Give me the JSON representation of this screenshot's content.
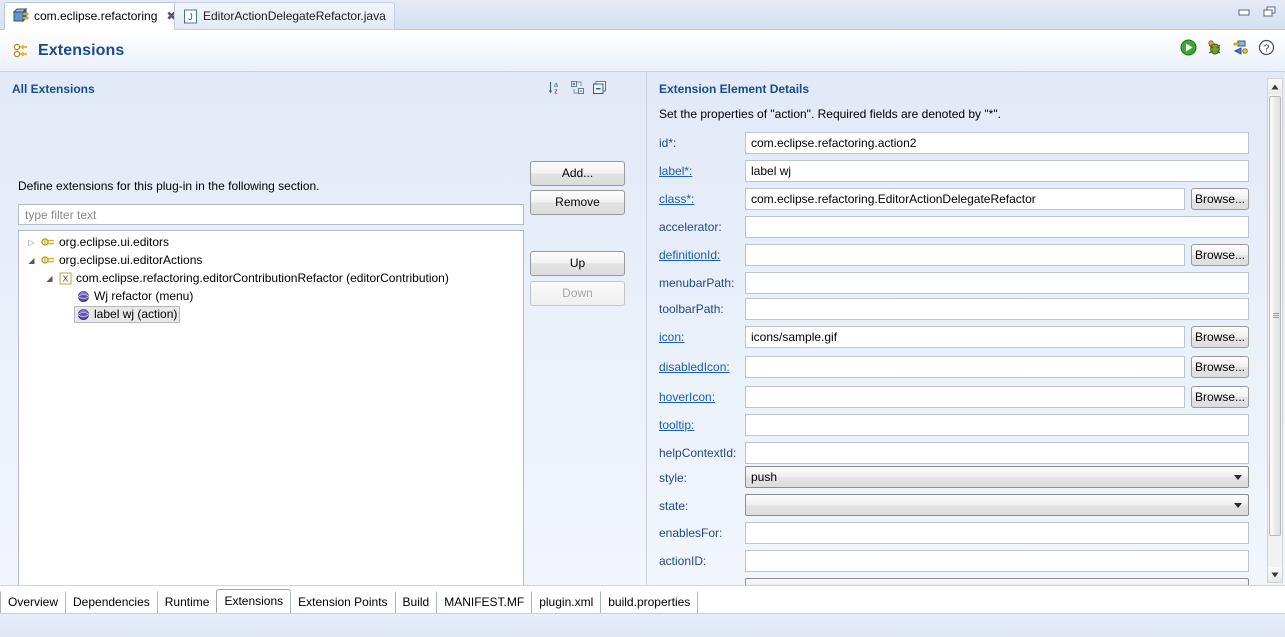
{
  "window": {
    "minimize_label": "minimize",
    "maximize_label": "maximize"
  },
  "editor_tabs": [
    {
      "label": "com.eclipse.refactoring",
      "icon": "plugin-icon",
      "active": true,
      "close": "✖"
    },
    {
      "label": "EditorActionDelegateRefactor.java",
      "icon": "java-file-icon",
      "active": false
    }
  ],
  "form_header": {
    "title": "Extensions",
    "icon": "extensions-icon",
    "tools": [
      {
        "name": "run-icon",
        "title": "Launch an Eclipse application"
      },
      {
        "name": "debug-icon",
        "title": "Launch an Eclipse application in Debug mode"
      },
      {
        "name": "export-plugin-icon",
        "title": "Export Wizard"
      },
      {
        "name": "help-icon",
        "title": "Help"
      }
    ]
  },
  "left_section": {
    "title": "All Extensions",
    "description": "Define extensions for this plug-in in the following section.",
    "tools": [
      {
        "name": "sort-az-icon",
        "title": "Sort alphabetically"
      },
      {
        "name": "expand-collapse-icon",
        "title": "Expand/Collapse"
      },
      {
        "name": "collapse-all-icon",
        "title": "Collapse All"
      }
    ],
    "filter": {
      "placeholder": "type filter text",
      "value": ""
    },
    "tree": [
      {
        "depth": 0,
        "twisty": "collapsed",
        "icon": "extension-point-icon",
        "label": "org.eclipse.ui.editors",
        "selected": false
      },
      {
        "depth": 0,
        "twisty": "expanded",
        "icon": "extension-point-icon",
        "label": "org.eclipse.ui.editorActions",
        "selected": false
      },
      {
        "depth": 1,
        "twisty": "expanded",
        "icon": "xml-element-icon",
        "label": "com.eclipse.refactoring.editorContributionRefactor (editorContribution)",
        "selected": false
      },
      {
        "depth": 2,
        "twisty": "none",
        "icon": "element-sphere-icon",
        "label": "Wj refactor (menu)",
        "selected": false
      },
      {
        "depth": 2,
        "twisty": "none",
        "icon": "element-sphere-icon",
        "label": "label wj (action)",
        "selected": true
      }
    ],
    "buttons": [
      {
        "label": "Add...",
        "enabled": true
      },
      {
        "label": "Remove",
        "enabled": true
      },
      {
        "label": "Up",
        "enabled": true
      },
      {
        "label": "Down",
        "enabled": false
      }
    ]
  },
  "right_section": {
    "title": "Extension Element Details",
    "description": "Set the properties of \"action\". Required fields are denoted by \"*\".",
    "fields": [
      {
        "label": "id*:",
        "link": false,
        "type": "text",
        "value": "com.eclipse.refactoring.action2",
        "browse": false
      },
      {
        "label": "label*:",
        "link": true,
        "type": "text",
        "value": "label wj",
        "browse": false
      },
      {
        "label": "class*:",
        "link": true,
        "type": "text",
        "value": "com.eclipse.refactoring.EditorActionDelegateRefactor",
        "browse": true,
        "browse_label": "Browse..."
      },
      {
        "label": "accelerator:",
        "link": false,
        "type": "text",
        "value": "",
        "browse": false
      },
      {
        "label": "definitionId:",
        "link": true,
        "type": "text",
        "value": "",
        "browse": true,
        "browse_label": "Browse..."
      },
      {
        "label": "menubarPath:",
        "link": false,
        "type": "text",
        "value": "",
        "browse": false
      },
      {
        "label": "toolbarPath:",
        "link": false,
        "type": "text",
        "value": "",
        "browse": false
      },
      {
        "label": "icon:",
        "link": true,
        "type": "text",
        "value": "icons/sample.gif",
        "browse": true,
        "browse_label": "Browse..."
      },
      {
        "label": "disabledIcon:",
        "link": true,
        "type": "text",
        "value": "",
        "browse": true,
        "browse_label": "Browse..."
      },
      {
        "label": "hoverIcon:",
        "link": true,
        "type": "text",
        "value": "",
        "browse": true,
        "browse_label": "Browse..."
      },
      {
        "label": "tooltip:",
        "link": true,
        "type": "text",
        "value": "",
        "browse": false
      },
      {
        "label": "helpContextId:",
        "link": false,
        "type": "text",
        "value": "",
        "browse": false
      },
      {
        "label": "style:",
        "link": false,
        "type": "combo",
        "value": "push",
        "browse": false
      },
      {
        "label": "state:",
        "link": false,
        "type": "combo",
        "value": "",
        "browse": false
      },
      {
        "label": "enablesFor:",
        "link": false,
        "type": "text",
        "value": "",
        "browse": false
      },
      {
        "label": "actionID:",
        "link": false,
        "type": "text",
        "value": "",
        "browse": false
      }
    ],
    "scrollbar": {
      "name": "details-vertical-scrollbar"
    }
  },
  "bottom_tabs": [
    {
      "label": "Overview",
      "active": false
    },
    {
      "label": "Dependencies",
      "active": false
    },
    {
      "label": "Runtime",
      "active": false
    },
    {
      "label": "Extensions",
      "active": true
    },
    {
      "label": "Extension Points",
      "active": false
    },
    {
      "label": "Build",
      "active": false
    },
    {
      "label": "MANIFEST.MF",
      "active": false
    },
    {
      "label": "plugin.xml",
      "active": false
    },
    {
      "label": "build.properties",
      "active": false
    }
  ],
  "colors": {
    "heading_blue": "#1a4b8c",
    "link_blue": "#1a5fb4",
    "label_blue": "#204a87",
    "selection_gray": "#e8e8e8"
  }
}
